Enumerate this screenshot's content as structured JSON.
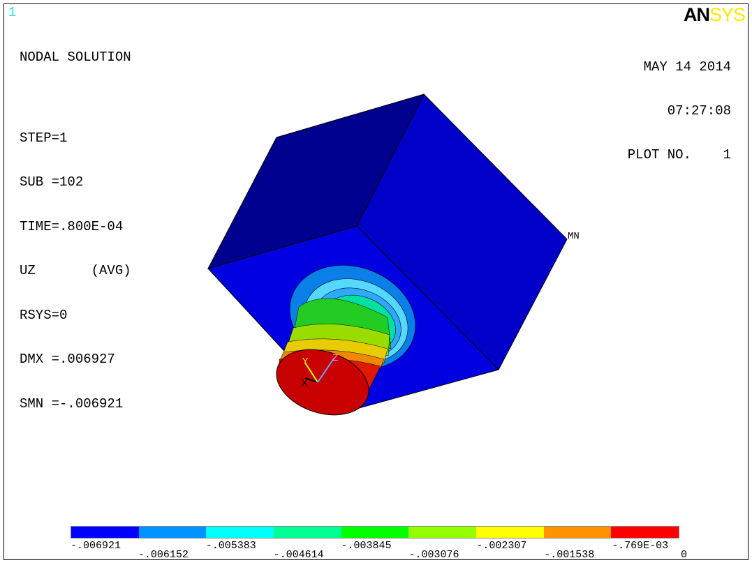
{
  "window_number": "1",
  "info_lines": [
    "NODAL SOLUTION",
    "STEP=1",
    "SUB =102",
    "TIME=.800E-04",
    "UZ       (AVG)",
    "RSYS=0",
    "DMX =.006927",
    "SMN =-.006921"
  ],
  "date": "MAY 14 2014",
  "time": "07:27:08",
  "plot_no": "PLOT NO.    1",
  "logo": {
    "part1": "AN",
    "part2": "SYS"
  },
  "model_labels": {
    "min_marker": "MN",
    "axis_x": "X",
    "axis_y": "Y",
    "axis_z": "Z"
  },
  "legend": {
    "colors": [
      "#0000ff",
      "#0093ff",
      "#00ffff",
      "#00ff93",
      "#00ff00",
      "#93ff00",
      "#ffff00",
      "#ff9300",
      "#ff0000"
    ],
    "ticks_upper": [
      "-.006921",
      "-.005383",
      "-.003845",
      "-.002307",
      "-.769E-03"
    ],
    "ticks_lower": [
      "-.006152",
      "-.004614",
      "-.003076",
      "-.001538",
      "0"
    ]
  }
}
